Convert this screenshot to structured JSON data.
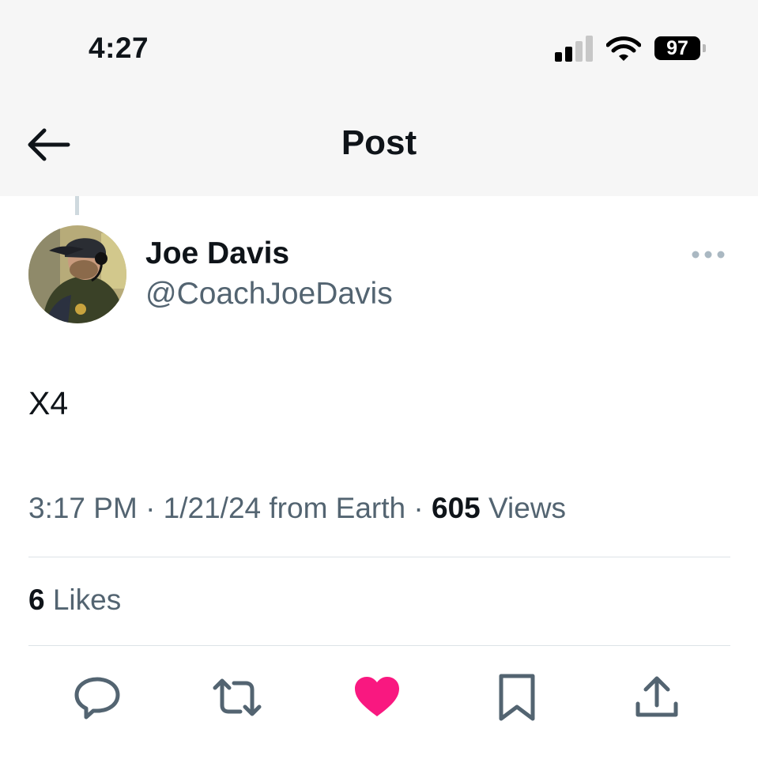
{
  "status_bar": {
    "time": "4:27",
    "battery": "97"
  },
  "header": {
    "title": "Post"
  },
  "post": {
    "author": {
      "display_name": "Joe Davis",
      "handle": "@CoachJoeDavis"
    },
    "text": "X4",
    "timestamp": "3:17 PM · 1/21/24 from Earth · ",
    "views_count": "605",
    "views_label": " Views",
    "likes_count": "6",
    "likes_label": " Likes"
  },
  "actions": {
    "liked": true,
    "like_color": "#f91880",
    "icon_color": "#536471"
  },
  "colors": {
    "text_primary": "#0f1419",
    "text_secondary": "#536471",
    "divider": "#dde3e7"
  }
}
